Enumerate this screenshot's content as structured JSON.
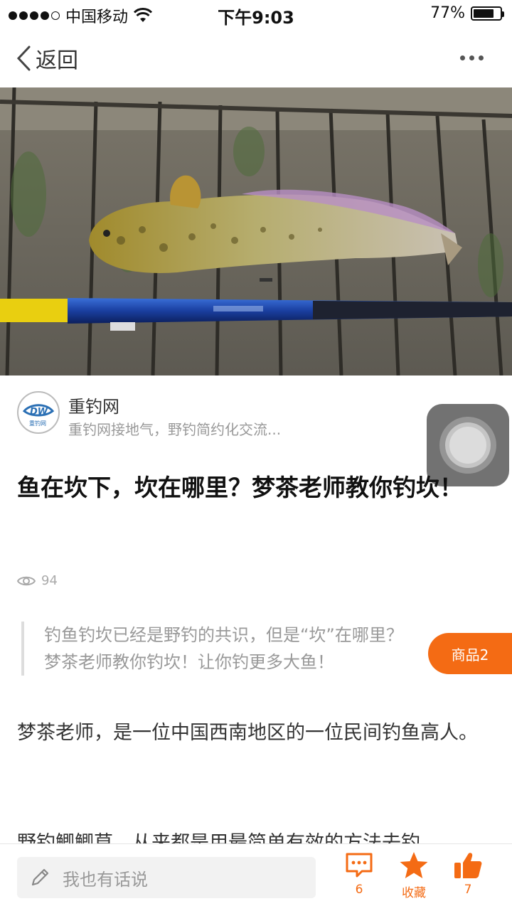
{
  "status_bar": {
    "carrier": "中国移动",
    "time": "下午9:03",
    "battery_percent": "77%",
    "battery_level": 0.77,
    "signal_bars_filled": 4,
    "signal_bars_total": 5
  },
  "nav": {
    "back_label": "返回",
    "more_icon": "more-dots-icon"
  },
  "hero": {
    "icon": "fish-photo"
  },
  "author": {
    "name": "重钓网",
    "description": "重钓网接地气，野钓简约化交流..."
  },
  "article": {
    "title": "鱼在坎下，坎在哪里？梦茶老师教你钓坎！",
    "views": "94",
    "quote_line1": "钓鱼钓坎已经是野钓的共识，但是“坎”在哪里？",
    "quote_line2": "梦茶老师教你钓坎！让你钓更多大鱼！",
    "paragraph1": "梦茶老师，是一位中国西南地区的一位民间钓鱼高人。",
    "paragraph2": "野钓鲫鲫草，从来都是用最简单有效的方法去钓"
  },
  "goods_tab": {
    "label": "商品2"
  },
  "bottom_bar": {
    "comment_placeholder": "我也有话说",
    "comment_count": "6",
    "favorite_label": "收藏",
    "like_count": "7",
    "accent_color": "#f46b14"
  }
}
